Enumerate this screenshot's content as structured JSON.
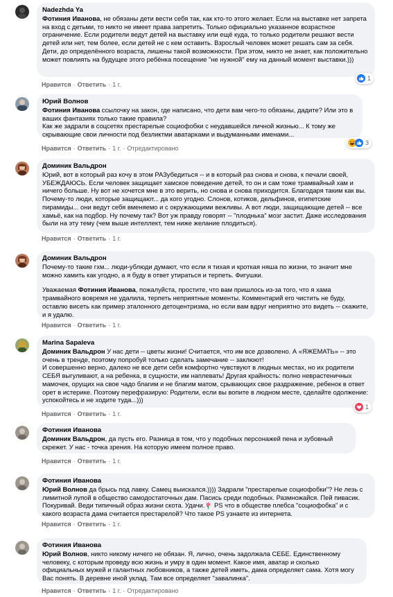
{
  "labels": {
    "like": "Нравится",
    "reply": "Ответить",
    "dot": "·",
    "edited": "Отредактировано"
  },
  "colors": {
    "bubble": "#f0f2f5",
    "secondary_text": "#65676b",
    "like_blue": "#1877f2",
    "love_red": "#f33e58",
    "haha_yellow": "#f7b125"
  },
  "comments": [
    {
      "author": "Nadezhda Ya",
      "mention": "Фотиния Иванова",
      "text": ", не обязаны дети вести себя так, как кто-то этого желает. Если на выставке нет запрета на вход с детьми, то никто не имеет права запретить. Только официально указанное возрастное ограничение. Если родители ведут детей на выставку или ещё куда, то только родители решают вести детей или нет, тем более, если детей не с кем оставить. Взрослый человек может решать сам за себя. Дети, до определённого возраста, лишены такой возможности. При этом, никто не знает, как положительно может повлиять на будущее этого ребёнка посещение \"не нужной\" ему на данный момент выставки.)))",
      "time": "1 г.",
      "reaction_count": "1"
    },
    {
      "author": "Юрий Волнов",
      "mention": "Фотиния Иванова",
      "text": " ссылочку на закон, где написано, что дети вам чего-то обязаны, дадите? Или это в ваших фантазиях только такие правила?\nКак же задрали в соцсетях престарелые социофобки с неудавшейся личной жизнью... К тому же скрывающие свои личности под безликтми аватарками и выдуманными именами...",
      "time": "1 г.",
      "reaction_count": "3"
    },
    {
      "author": "Доминик Вальдрон",
      "mention": "",
      "text": "Юрий, вот в который раз кочу в этом РАЗубедиться -- и в который раз снова и снова, к печали своей, УБЕЖДАЮСЬ. Если человек защищает хамское поведение детей, то он и сам тоже трамвайный хам и ничего больше. Ну вот не хочется мне в это верить, но снова и снова приходится. Благодаря таким как вы. Почему-то люди, которые защищают... да кого угодно. Слонов, котиков, дельфинов, египетские пирамиды... они ведут себя вменяемо и с окружающими вежливы. А вот люди, защищающие детей -- все хамьё, как на подбор. Ну почему так? Вот уж правду говорят -- \"плоднька\" мозг застит. Даже исследования были на эту тему (чем выше интеллект, тем ниже желание плодиться).",
      "time": "1 г."
    },
    {
      "author": "Доминик Вальдрон",
      "mention": "Фотиния Иванова",
      "text_before": "Почему-то такие гхм... люди-ублюди думают, что если я тихая и кроткая няша по жизни, то значит мне можно хамить как угодно, а я буду в ответ утираться и терпеть. Фигушки.",
      "text_prefix": "Уважаемая ",
      "text": ", пожалуйста, простите, что вам пришлось из-за того, что я хама трамвайного вовремя не удалила, терпеть неприятные моменты. Комментарий его чистить не буду, оставлю висеть как пример эталонного детоцентризма, но если вам вдруг неприятно это видеть -- скажите, и я удалю.",
      "time": "1 г."
    },
    {
      "author": "Marina Sapaleva",
      "mention": "Доминик Вальдрон",
      "text": " У нас дети -- цветы жизни! Считается, что им все дозволено. А «ЯЖЕМАТЬ» -- это очень в тренде, поэтому попробуй только сделать замечание -- заклюют!\nИ совершенно верно, далеко не все дети себя комфортно чувствуют в людных местах, но их родители СЕБЯ выгуливают, а на ребенка, в сущности, им наплевать! Другая крайность: полно неврастеничных мамочек, орущих на свое чадо благим и не благим матом, срывающих свое раздражение, ребенок в ответ орет в истерике. Поэтому перефразирую: Родители, если вы вопите в людном месте, сделайте одолжение: успокойтесь и не ходите туда...)))",
      "time": "1 г.",
      "reaction_count": "1"
    },
    {
      "author": "Фотиния Иванова",
      "mention": "Доминик Вальдрон",
      "text": ", да пусть его. Разница в том, что у подобных персонажей пена и зубовный скрежет. У нас - точка зрения. На которую имеем полное право.",
      "time": "1 г."
    },
    {
      "author": "Фотиния Иванова",
      "mention": "Юрий Волнов",
      "text_a": " да брысь под лавку. Самец выискался.)))) Задрали \"престарелые социофобки\"? Не лезь с лимитной лупой в общество самодостаточных дам. Пасись среди подобных. Размножайся. Пей пивасик. Покуривай. Веди типичный образ жизни скота. Удачи.",
      "text_b": " PS что в обществе плебса \"социофобка\" и с какого возраста дама считается престарелой? Что такое PS узнаете из интернета.",
      "time": "1 г."
    },
    {
      "author": "Фотиния Иванова",
      "mention": "Юрий Волнов",
      "text": ", никто никому ничего не обязан. Я, лично, очень задолжала СЕБЕ. Единственному человеку, с которым проведу всю жизнь и умру в один момент. Какое имя, аватар и сколько официальных мужей и галантных любовников, а также детей иметь, дама определяет сама. Хотя могу Вас понять. В деревне иной уклад. Там все определяет \"завалинка\".",
      "time": "1 г."
    }
  ]
}
